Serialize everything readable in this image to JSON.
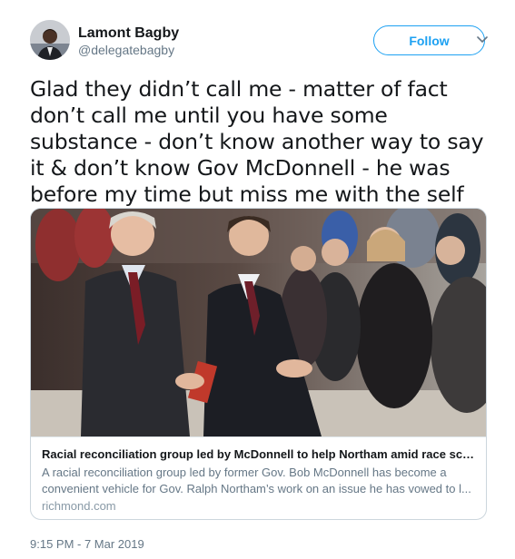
{
  "user": {
    "display_name": "Lamont Bagby",
    "handle": "@delegatebagby",
    "avatar_icon": "user-avatar-photo"
  },
  "actions": {
    "follow_label": "Follow",
    "more_icon": "chevron-down-icon"
  },
  "tweet": {
    "text": "Glad they didn’t call me - matter of fact don’t call me until you have some substance - don’t know another way to say it & don’t know Gov McDonnell - he was before my time but miss me with the self preservation/privilege",
    "timestamp": "9:15 PM - 7 Mar 2019"
  },
  "card": {
    "title": "Racial reconciliation group led by McDonnell to help Northam amid race scan...",
    "description": "A racial reconciliation group led by former Gov. Bob McDonnell has become a convenient vehicle for Gov. Ralph Northam’s work on an issue he has vowed to l...",
    "domain": "richmond.com"
  },
  "colors": {
    "accent": "#1da1f2",
    "text": "#14171a",
    "muted": "#657786",
    "border": "#ccd6dd"
  }
}
